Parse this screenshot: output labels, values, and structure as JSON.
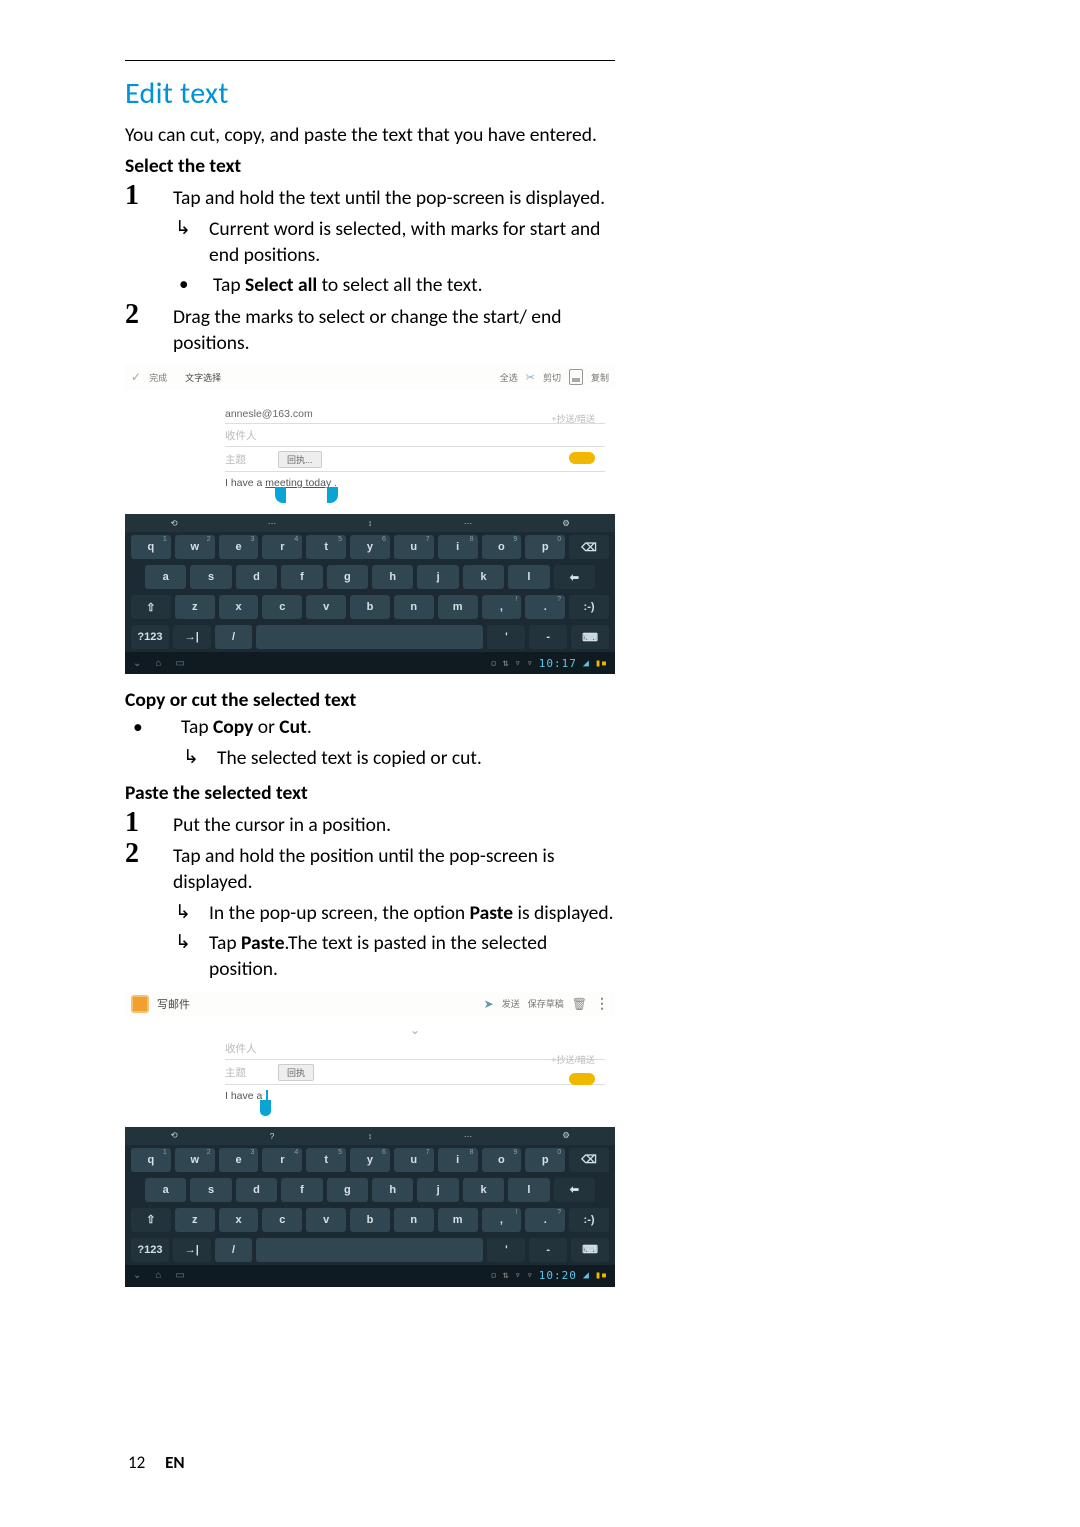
{
  "title": "Edit text",
  "intro": "You can cut, copy, and paste the text that you have entered.",
  "select_head": "Select the text",
  "select_steps": [
    {
      "num": "1",
      "text": "Tap and hold the text until the pop-screen is displayed.",
      "subs": [
        {
          "type": "arrow",
          "text": "Current word is selected, with marks for start and end positions."
        },
        {
          "type": "dot",
          "pre": "Tap ",
          "bold": "Select all",
          "post": " to select all the text."
        }
      ]
    },
    {
      "num": "2",
      "text": "Drag the marks to select or change the start/ end positions.",
      "subs": []
    }
  ],
  "copy_head": "Copy or cut the selected text",
  "copy_bullets": [
    {
      "pre": "Tap ",
      "bold1": "Copy",
      "mid": " or ",
      "bold2": "Cut",
      "post": "."
    }
  ],
  "copy_sub": {
    "text": "The selected text is copied or cut."
  },
  "paste_head": "Paste the selected text",
  "paste_steps": [
    {
      "num": "1",
      "text": "Put the cursor in a position.",
      "subs": []
    },
    {
      "num": "2",
      "text": "Tap and hold the position until the pop-screen is displayed.",
      "subs": [
        {
          "type": "arrow",
          "pre": "In the pop-up screen, the option ",
          "bold": "Paste",
          "post": " is displayed."
        },
        {
          "type": "arrow",
          "pre": "Tap ",
          "bold": "Paste",
          "post": ".The text is pasted in the selected position."
        }
      ]
    }
  ],
  "shot1": {
    "top_left": [
      "完成",
      "文字选择"
    ],
    "top_right": [
      "全选",
      "剪切",
      "复制"
    ],
    "email_to": "annesle@163.com",
    "recipient_lbl": "收件人",
    "subject_lbl": "主题",
    "subject_tag": "回执...",
    "addcc": "+抄送/暗送",
    "body_pre": "I have a ",
    "body_sel": "meeting today",
    "body_post": " .",
    "editbar": [
      "",
      "",
      "",
      "",
      ""
    ],
    "clock": "10:17"
  },
  "shot2": {
    "title": "写邮件",
    "top_right": [
      "发送",
      "保存草稿"
    ],
    "recipient_lbl": "收件人",
    "subject_lbl": "主题",
    "subject_tag": "回执",
    "addcc": "+抄送/暗送",
    "body": "I have a",
    "editbar": [
      "",
      "",
      "",
      "",
      ""
    ],
    "clock": "10:20"
  },
  "keyboard": {
    "r1": [
      "q",
      "w",
      "e",
      "r",
      "t",
      "y",
      "u",
      "i",
      "o",
      "p"
    ],
    "r2": [
      "a",
      "s",
      "d",
      "f",
      "g",
      "h",
      "j",
      "k",
      "l"
    ],
    "r3_mid": [
      "z",
      "x",
      "c",
      "v",
      "b",
      "n",
      "m",
      ",",
      "."
    ],
    "shift": "⇧",
    "del": "⌫",
    "enter": "⬅",
    "smile": ":-)",
    "numkey": "?123",
    "lang": "→|",
    "slash": "/",
    "apos": "'",
    "dash": "-",
    "kbdicon": "⌨"
  },
  "footer": {
    "page": "12",
    "lang": "EN"
  }
}
